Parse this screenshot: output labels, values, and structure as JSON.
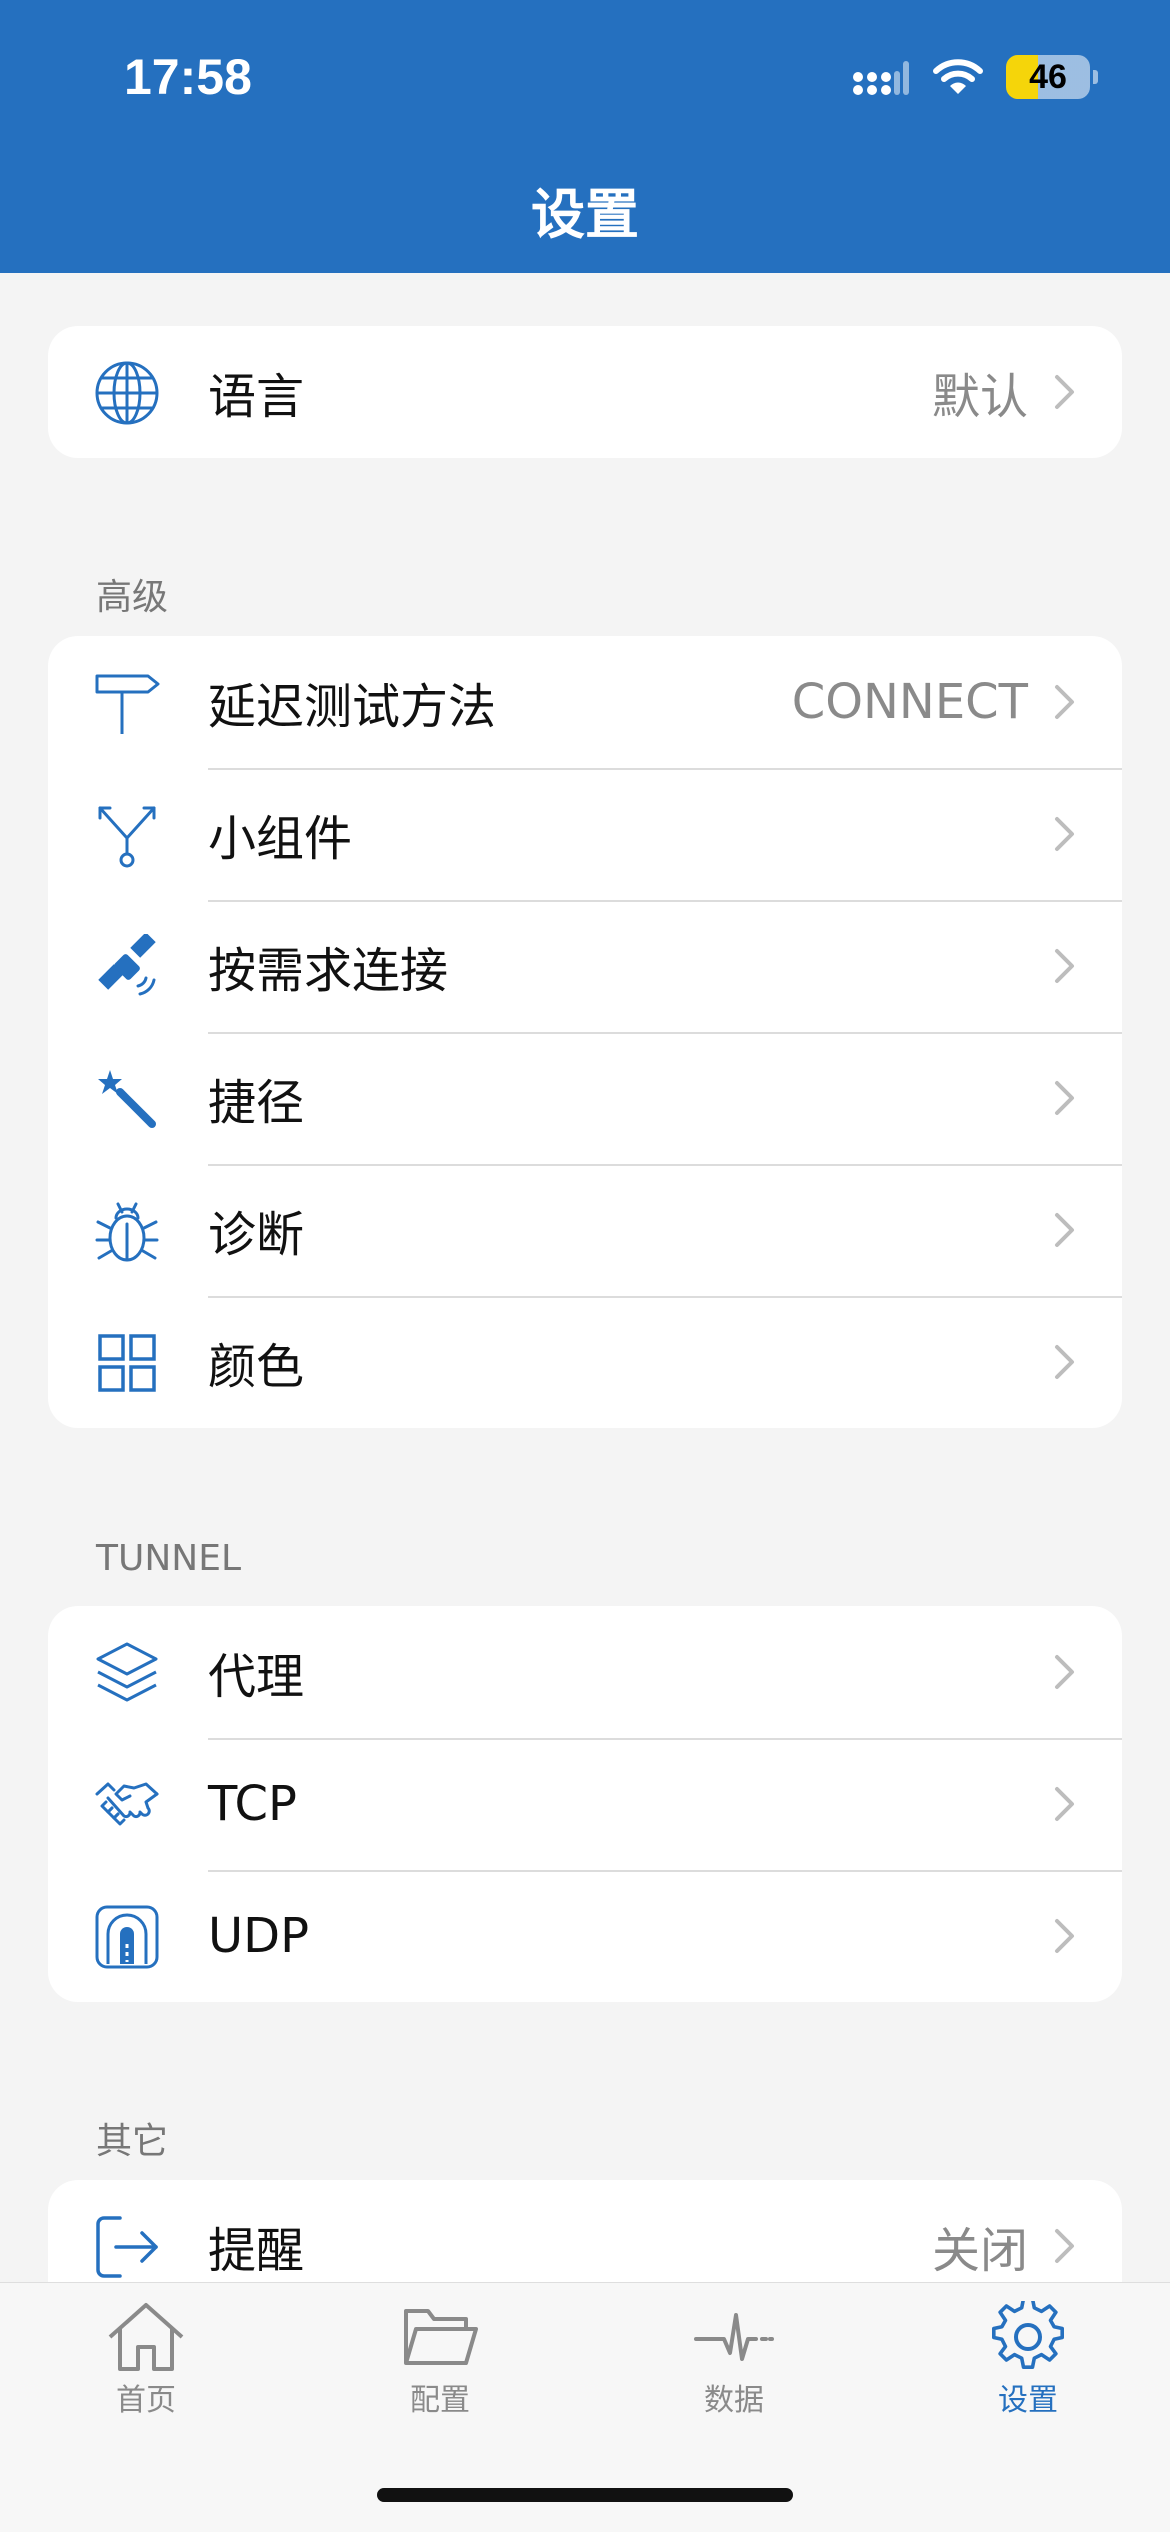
{
  "status_bar": {
    "time": "17:58",
    "battery": "46"
  },
  "header": {
    "title": "设置"
  },
  "language": {
    "label": "语言",
    "value": "默认"
  },
  "advanced": {
    "section": "高级",
    "items": [
      {
        "label": "延迟测试方法",
        "value": "CONNECT",
        "icon": "signpost-icon"
      },
      {
        "label": "小组件",
        "value": "",
        "icon": "fork-icon"
      },
      {
        "label": "按需求连接",
        "value": "",
        "icon": "satellite-icon"
      },
      {
        "label": "捷径",
        "value": "",
        "icon": "magic-wand-icon"
      },
      {
        "label": "诊断",
        "value": "",
        "icon": "bug-icon"
      },
      {
        "label": "颜色",
        "value": "",
        "icon": "grid-icon"
      }
    ]
  },
  "tunnel": {
    "section": "TUNNEL",
    "items": [
      {
        "label": "代理",
        "icon": "layers-icon"
      },
      {
        "label": "TCP",
        "icon": "handshake-icon"
      },
      {
        "label": "UDP",
        "icon": "tunnel-icon"
      }
    ]
  },
  "other": {
    "section": "其它",
    "items": [
      {
        "label": "提醒",
        "value": "关闭",
        "icon": "exit-arrow-icon"
      }
    ]
  },
  "tabbar": {
    "tabs": [
      {
        "label": "首页",
        "icon": "home-icon"
      },
      {
        "label": "配置",
        "icon": "folder-icon"
      },
      {
        "label": "数据",
        "icon": "pulse-icon"
      },
      {
        "label": "设置",
        "icon": "gear-icon"
      }
    ],
    "active": "设置"
  },
  "colors": {
    "accent": "#2570bf",
    "background": "#f4f4f4"
  }
}
